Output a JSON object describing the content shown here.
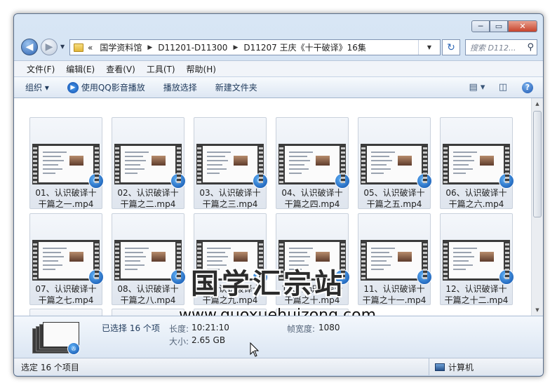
{
  "window": {
    "controls": [
      "─",
      "▭",
      "✕"
    ]
  },
  "nav": {
    "back_glyph": "◀",
    "forward_glyph": "▶",
    "history_glyph": "▼",
    "chevron": "«",
    "breadcrumbs": [
      "国学资料馆",
      "D11201-D11300",
      "D11207 王庆《十干破译》16集"
    ],
    "separator": "▶",
    "address_dropdown_glyph": "▼",
    "refresh_glyph": "↻",
    "search_placeholder": "搜索 D112...",
    "search_glyph": "⚲"
  },
  "menubar": [
    "文件(F)",
    "编辑(E)",
    "查看(V)",
    "工具(T)",
    "帮助(H)"
  ],
  "toolbar": {
    "organize": "组织 ▾",
    "qq_play": "使用QQ影音播放",
    "playlist": "播放选择",
    "new_folder": "新建文件夹",
    "view_glyph": "▤ ▾",
    "pane_glyph": "◫",
    "help_glyph": "?"
  },
  "files": [
    {
      "line1": "01、认识破译十",
      "line2": "干篇之一.mp4"
    },
    {
      "line1": "02、认识破译十",
      "line2": "干篇之二.mp4"
    },
    {
      "line1": "03、认识破译十",
      "line2": "干篇之三.mp4"
    },
    {
      "line1": "04、认识破译十",
      "line2": "干篇之四.mp4"
    },
    {
      "line1": "05、认识破译十",
      "line2": "干篇之五.mp4"
    },
    {
      "line1": "06、认识破译十",
      "line2": "干篇之六.mp4"
    },
    {
      "line1": "07、认识破译十",
      "line2": "干篇之七.mp4"
    },
    {
      "line1": "08、认识破译十",
      "line2": "干篇之八.mp4"
    },
    {
      "line1": "09、认识破译十",
      "line2": "干篇之九.mp4"
    },
    {
      "line1": "10、认识破译十",
      "line2": "干篇之十.mp4"
    },
    {
      "line1": "11、认识破译十",
      "line2": "干篇之十一.mp4"
    },
    {
      "line1": "12、认识破译十",
      "line2": "干篇之十二.mp4"
    }
  ],
  "video_badge_glyph": "✇",
  "watermark": {
    "title": "国学汇宗站",
    "url": "www.guoxuehuizong.com"
  },
  "details": {
    "selected": "已选择 16 个项",
    "length_label": "长度:",
    "length_value": "10:21:10",
    "width_label": "帧宽度:",
    "width_value": "1080",
    "size_label": "大小:",
    "size_value": "2.65 GB"
  },
  "status": {
    "left": "选定 16 个项目",
    "right": "计算机"
  },
  "scroll": {
    "up_glyph": "▲",
    "down_glyph": "▼"
  }
}
